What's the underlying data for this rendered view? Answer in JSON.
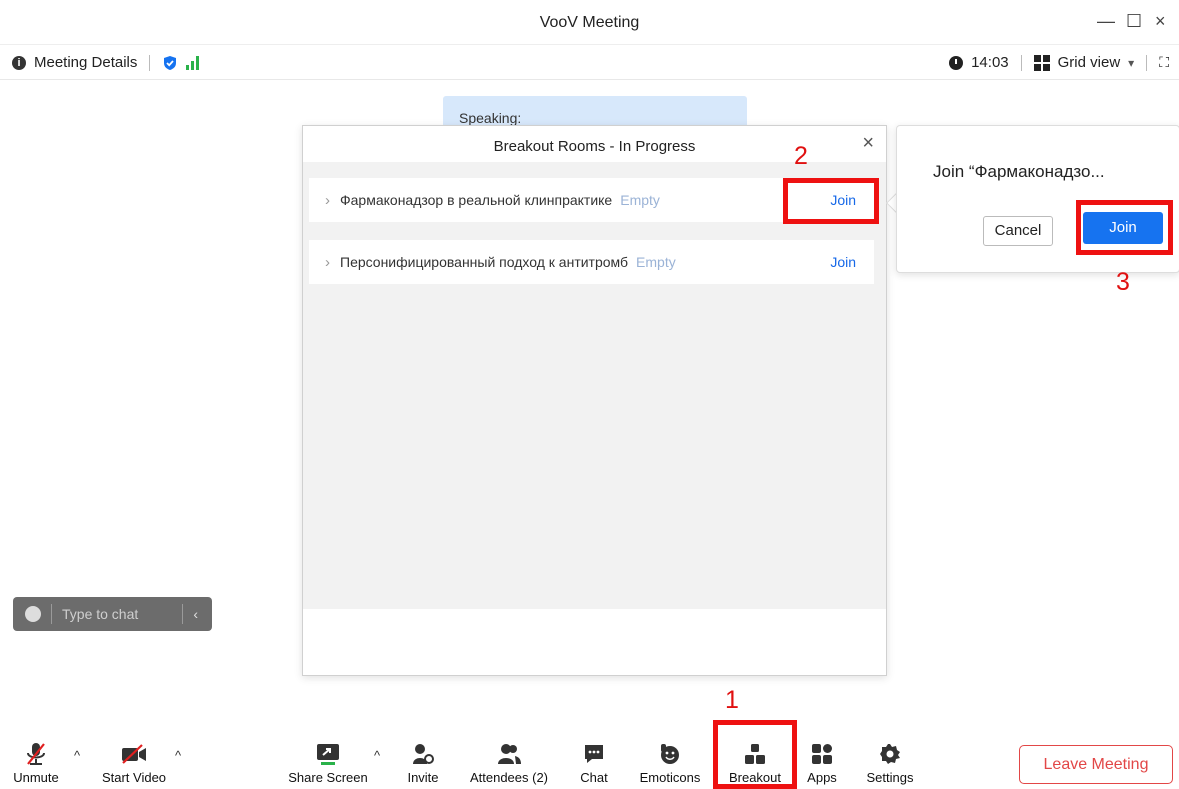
{
  "window": {
    "title": "VooV Meeting",
    "minimize": "—",
    "maximize": "☐",
    "close": "×"
  },
  "infobar": {
    "meeting_details": "Meeting Details",
    "time": "14:03",
    "view": "Grid view",
    "caret": "▾",
    "fullscreen": "⛶"
  },
  "speaking": "Speaking:",
  "dialog": {
    "title": "Breakout Rooms - In Progress",
    "close": "×",
    "rooms": [
      {
        "name": "Фармаконадзор в реальной клинпрактике",
        "status": "Empty",
        "action": "Join"
      },
      {
        "name": "Персонифицированный подход к антитромб",
        "status": "Empty",
        "action": "Join"
      }
    ]
  },
  "popover": {
    "text": "Join  “Фармаконадзо...",
    "cancel": "Cancel",
    "join": "Join"
  },
  "chat": {
    "placeholder": "Type to chat",
    "collapse": "‹"
  },
  "toolbar": {
    "unmute": "Unmute",
    "start_video": "Start Video",
    "share_screen": "Share Screen",
    "invite": "Invite",
    "attendees": "Attendees (2)",
    "chat": "Chat",
    "emoticons": "Emoticons",
    "breakout": "Breakout",
    "apps": "Apps",
    "settings": "Settings",
    "leave": "Leave Meeting",
    "caret": "^"
  },
  "annotations": {
    "step1": "1",
    "step2": "2",
    "step3": "3"
  },
  "colors": {
    "accent": "#1673f0",
    "highlight": "#ee1111",
    "leave": "#e24747",
    "signal": "#2ab24a"
  }
}
